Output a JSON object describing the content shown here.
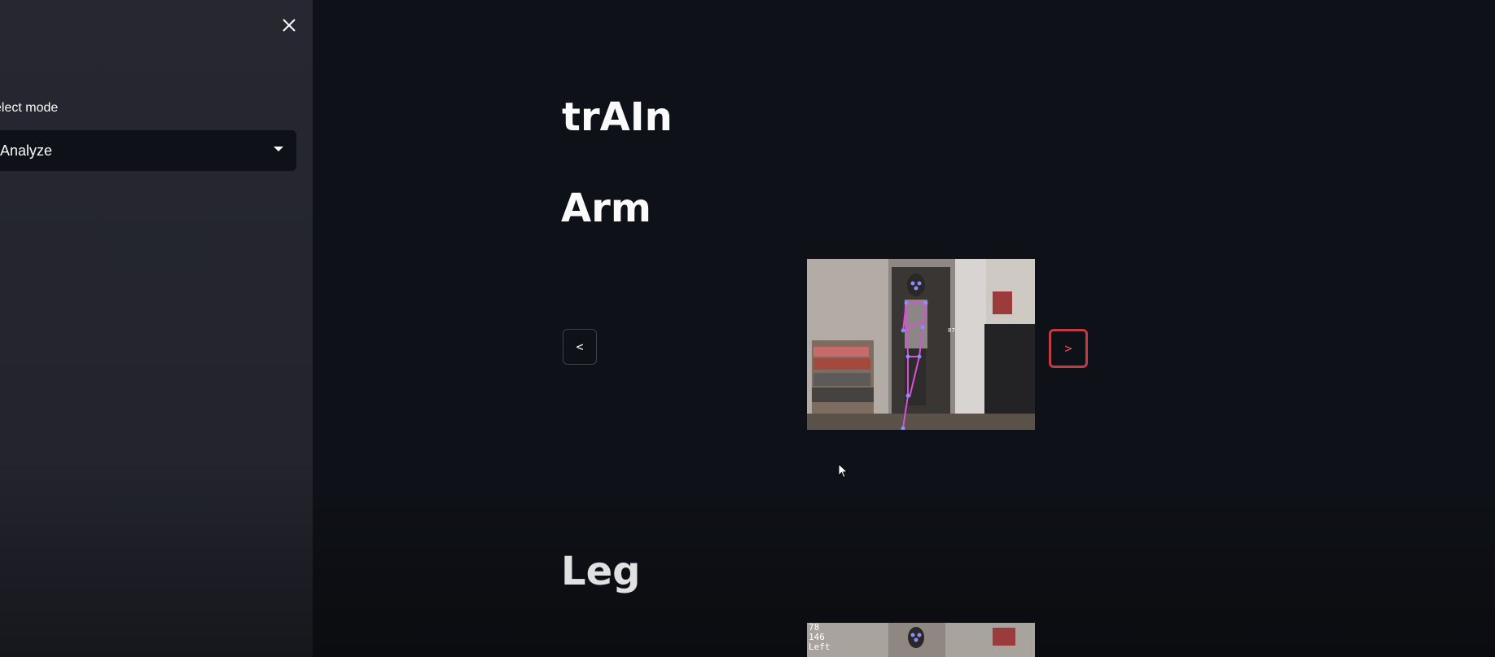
{
  "sidebar": {
    "select_label": "elect mode",
    "select_value": "Analyze",
    "close_icon": "close-icon",
    "caret_icon": "chevron-down-icon"
  },
  "main": {
    "title": "trAIn",
    "sections": [
      {
        "heading": "Arm",
        "prev_label": "<",
        "next_label": ">",
        "frame_annotation": "87"
      },
      {
        "heading": "Leg",
        "overlay_lines": [
          "78",
          "146",
          "Left"
        ]
      }
    ]
  },
  "colors": {
    "sidebar_bg": "#262730",
    "main_bg": "#0e1117",
    "accent": "#ff4b4b",
    "skeleton": "#d84fd8"
  }
}
